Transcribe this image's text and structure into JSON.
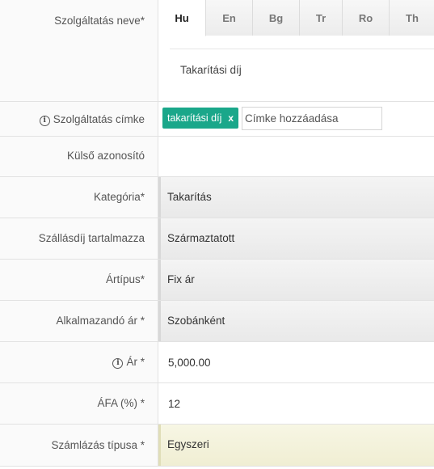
{
  "form": {
    "name_label": "Szolgáltatás neve*",
    "languages": [
      {
        "code": "Hu",
        "active": true
      },
      {
        "code": "En",
        "active": false
      },
      {
        "code": "Bg",
        "active": false
      },
      {
        "code": "Tr",
        "active": false
      },
      {
        "code": "Ro",
        "active": false
      },
      {
        "code": "Th",
        "active": false
      }
    ],
    "name_value": "Takarítási díj",
    "tag_label": "Szolgáltatás címke",
    "tag_info_icon": "ⓘ",
    "tags": [
      {
        "label": "takarítási díj",
        "remove": "x"
      }
    ],
    "tag_input_placeholder": "Címke hozzáadása",
    "external_id_label": "Külső azonosító",
    "external_id_value": "",
    "category_label": "Kategória*",
    "category_value": "Takarítás",
    "shipping_label": "Szállásdíj tartalmazza",
    "shipping_value": "Származtatott",
    "price_type_label": "Ártípus*",
    "price_type_value": "Fix ár",
    "applied_price_label": "Alkalmazandó ár *",
    "applied_price_value": "Szobánként",
    "price_label": "Ár *",
    "price_info_icon": "ⓘ",
    "price_value": "5,000.00",
    "vat_label": "ÁFA (%) *",
    "vat_value": "12",
    "billing_label": "Számlázás típusa *",
    "billing_value": "Egyszeri"
  }
}
